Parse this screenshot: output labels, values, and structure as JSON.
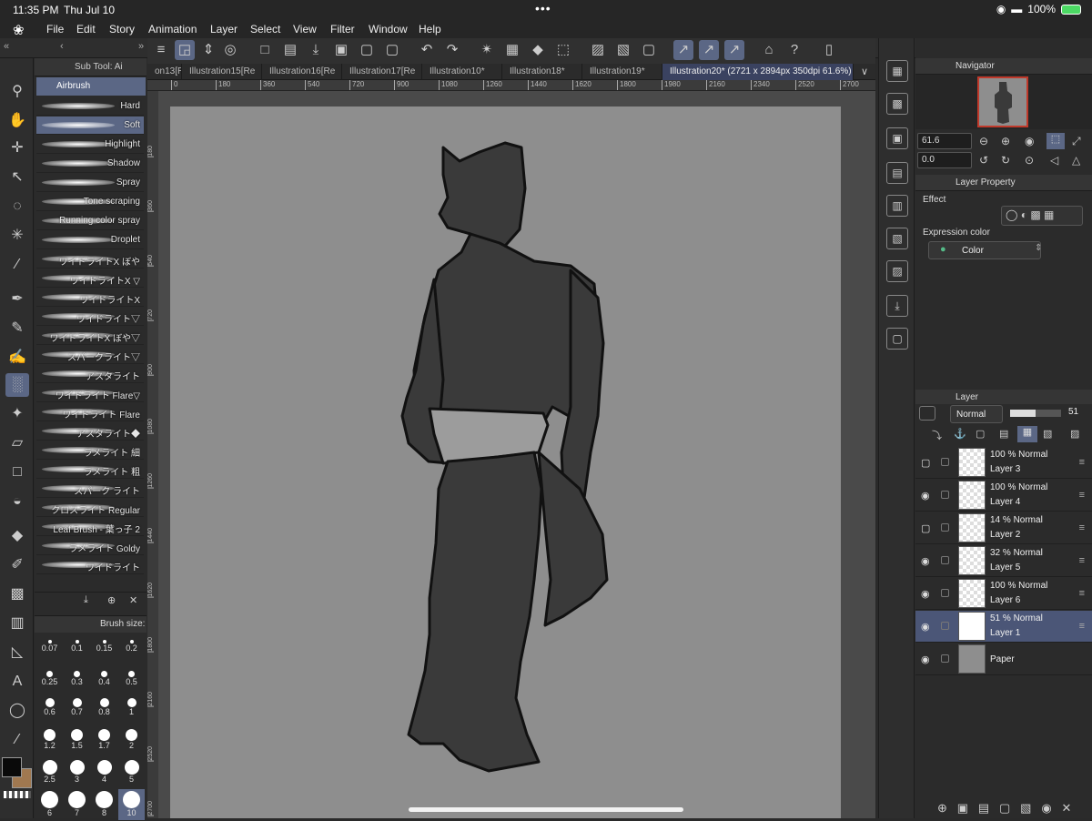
{
  "status": {
    "time": "11:35 PM",
    "date": "Thu Jul 10",
    "battery": "100%"
  },
  "menu": [
    "File",
    "Edit",
    "Story",
    "Animation",
    "Layer",
    "Select",
    "View",
    "Filter",
    "Window",
    "Help"
  ],
  "subtool": {
    "header": "Sub Tool: Ai",
    "group": "Airbrush",
    "brushes": [
      "Hard",
      "Soft",
      "Highlight",
      "Shadow",
      "Spray",
      "Tone scraping",
      "Running color spray",
      "Droplet",
      "ワイドライトX ぼや",
      "ワイドライトX ▽",
      "ワイドライトX",
      "ワイドライト▽",
      "ワイドライトX ぼや▽",
      "スパークライト▽",
      "アスタライト",
      "ワイドライト Flare▽",
      "ワイドライト Flare",
      "アスタライト◆",
      "ラメライト 細",
      "ラメライト 粗",
      "スパーク ライト",
      "クロスライト Regular",
      "Leaf Brush - 葉っ子 2",
      "ラメライト Goldy",
      "ワイドライト"
    ],
    "selected_index": 1
  },
  "brush_size": {
    "header": "Brush size:",
    "sizes": [
      "0.07",
      "0.1",
      "0.15",
      "0.2",
      "0.25",
      "0.3",
      "0.4",
      "0.5",
      "0.6",
      "0.7",
      "0.8",
      "1",
      "1.2",
      "1.5",
      "1.7",
      "2",
      "2.5",
      "3",
      "4",
      "5",
      "6",
      "7",
      "8",
      "10"
    ],
    "selected": "10"
  },
  "colors": {
    "main": "#0a0a0a",
    "sub": "#a07850",
    "accent": "#5b6785"
  },
  "tabs": [
    {
      "label": "on13[Re"
    },
    {
      "label": "Illustration15[Re"
    },
    {
      "label": "Illustration16[Re"
    },
    {
      "label": "Illustration17[Re"
    },
    {
      "label": "Illustration10*"
    },
    {
      "label": "Illustration18*"
    },
    {
      "label": "Illustration19*"
    },
    {
      "label": "Illustration20* (2721 x 2894px 350dpi 61.6%)"
    }
  ],
  "ruler_h": [
    "0",
    "180",
    "360",
    "540",
    "720",
    "900",
    "1080",
    "1260",
    "1440",
    "1620",
    "1800",
    "1980",
    "2160",
    "2340",
    "2520",
    "2700"
  ],
  "ruler_v": [
    "180",
    "360",
    "540",
    "720",
    "900",
    "1080",
    "1260",
    "1440",
    "1620",
    "1800",
    "2160",
    "2520",
    "2700"
  ],
  "navigator": {
    "title": "Navigator",
    "zoom": "61.6",
    "rotation": "0.0"
  },
  "layer_property": {
    "title": "Layer Property",
    "effect": "Effect",
    "expression": "Expression color",
    "color_value": "Color"
  },
  "layer_panel": {
    "title": "Layer",
    "blend": "Normal",
    "opacity": "51"
  },
  "layers": [
    {
      "opacity": "100 %  Normal",
      "name": "Layer 3",
      "visible": false,
      "selected": false
    },
    {
      "opacity": "100 %  Normal",
      "name": "Layer 4",
      "visible": true,
      "selected": false
    },
    {
      "opacity": "14 %  Normal",
      "name": "Layer 2",
      "visible": false,
      "selected": false
    },
    {
      "opacity": "32 %  Normal",
      "name": "Layer 5",
      "visible": true,
      "selected": false
    },
    {
      "opacity": "100 %  Normal",
      "name": "Layer 6",
      "visible": true,
      "selected": false
    },
    {
      "opacity": "51 %  Normal",
      "name": "Layer 1",
      "visible": true,
      "selected": true
    },
    {
      "opacity": "",
      "name": "Paper",
      "visible": true,
      "selected": false
    }
  ]
}
